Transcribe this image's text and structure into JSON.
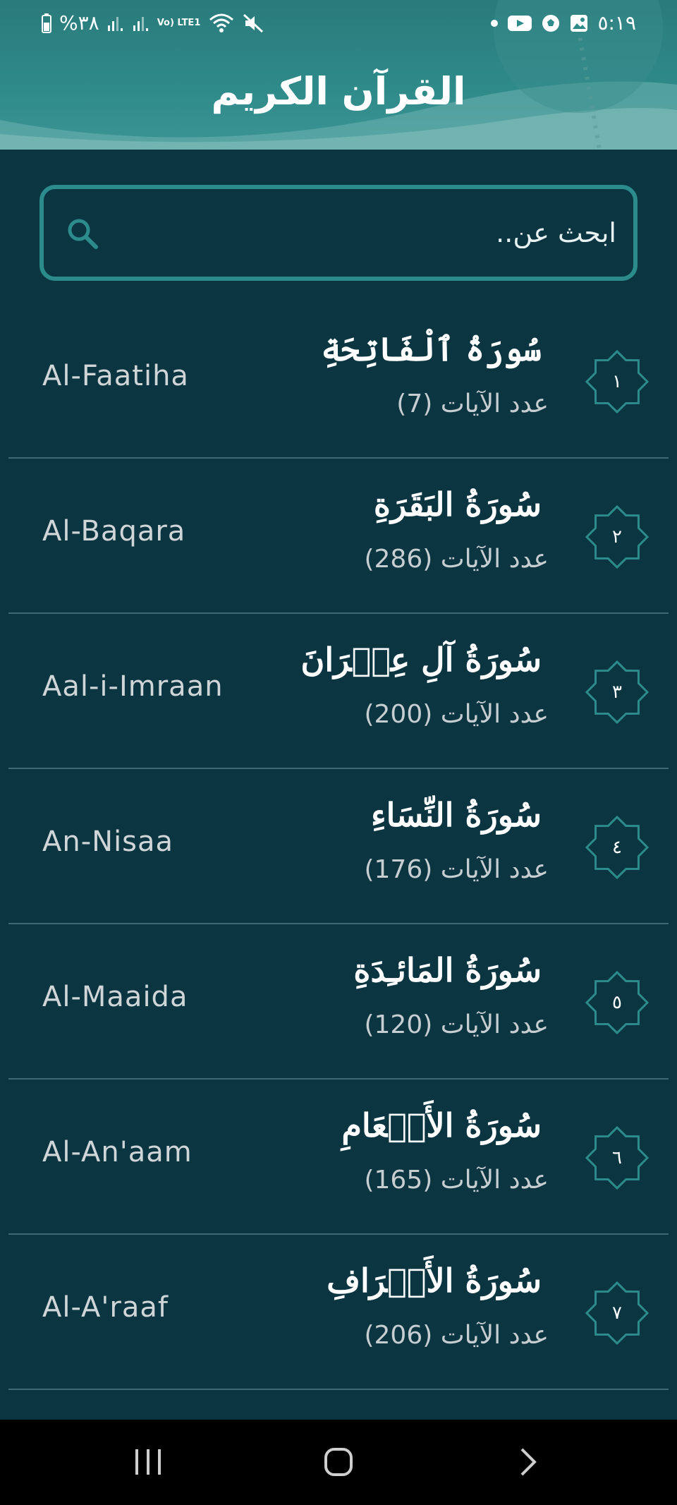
{
  "status_bar": {
    "battery_text": "%٣٨",
    "network_label": "Vo) LTE1",
    "time": "٥:١٩",
    "icons": [
      "battery-icon",
      "signal-icon",
      "signal-icon",
      "volte-icon",
      "wifi-icon",
      "mute-icon",
      "dot-icon",
      "youtube-icon",
      "football-icon",
      "gallery-icon"
    ]
  },
  "header": {
    "title": "القرآن الكريم"
  },
  "search": {
    "placeholder": "ابحث عن..",
    "value": ""
  },
  "surahs": [
    {
      "number": "١",
      "arabic": "سُورَةُ ٱلْفَاتِحَةِ",
      "ayat": "عدد الآيات (7)",
      "latin": "Al-Faatiha"
    },
    {
      "number": "٢",
      "arabic": "سُورَةُ البَقَرَةِ",
      "ayat": "عدد الآيات (286)",
      "latin": "Al-Baqara"
    },
    {
      "number": "٣",
      "arabic": "سُورَةُ آلِ عِمۡرَانَ",
      "ayat": "عدد الآيات (200)",
      "latin": "Aal-i-Imraan"
    },
    {
      "number": "٤",
      "arabic": "سُورَةُ النِّسَاءِ",
      "ayat": "عدد الآيات (176)",
      "latin": "An-Nisaa"
    },
    {
      "number": "٥",
      "arabic": "سُورَةُ المَائـِدَةِ",
      "ayat": "عدد الآيات (120)",
      "latin": "Al-Maaida"
    },
    {
      "number": "٦",
      "arabic": "سُورَةُ الأَنۡعَامِ",
      "ayat": "عدد الآيات (165)",
      "latin": "Al-An'aam"
    },
    {
      "number": "٧",
      "arabic": "سُورَةُ الأَعۡرَافِ",
      "ayat": "عدد الآيات (206)",
      "latin": "Al-A'raaf"
    }
  ],
  "nav": {
    "recents": "recents-icon",
    "home": "home-icon",
    "back": "back-icon"
  },
  "colors": {
    "background": "#0c3542",
    "header": "#2f8a8a",
    "accent": "#2c8c8c",
    "divider": "#3f6a74"
  }
}
